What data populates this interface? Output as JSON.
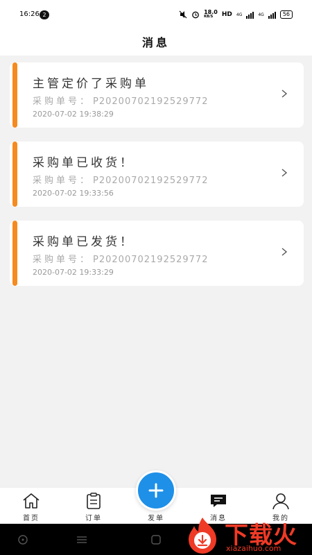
{
  "status_bar": {
    "time": "16:26",
    "notification_count": "2",
    "speed": "18.0",
    "speed_unit": "KB/S",
    "hd_label": "HD",
    "network_1": "4G",
    "network_2": "4G",
    "battery": "56"
  },
  "header": {
    "title": "消息"
  },
  "messages": [
    {
      "title": "主管定价了采购单",
      "order_label": "采购单号：",
      "order_no": "P20200702192529772",
      "time": "2020-07-02 19:38:29"
    },
    {
      "title": "采购单已收货！",
      "order_label": "采购单号：",
      "order_no": "P20200702192529772",
      "time": "2020-07-02 19:33:56"
    },
    {
      "title": "采购单已发货！",
      "order_label": "采购单号：",
      "order_no": "P20200702192529772",
      "time": "2020-07-02 19:33:29"
    }
  ],
  "tabbar": {
    "tabs": [
      {
        "label": "首页",
        "icon": "home-icon"
      },
      {
        "label": "订单",
        "icon": "clipboard-icon"
      },
      {
        "label": "发单",
        "icon": "plus-icon"
      },
      {
        "label": "消息",
        "icon": "message-icon"
      },
      {
        "label": "我的",
        "icon": "user-icon"
      }
    ]
  },
  "colors": {
    "accent": "#f58a1f",
    "fab": "#1e90e8",
    "background": "#f2f2f2"
  },
  "watermark": {
    "text": "下载火",
    "url": "xiazaihuo.com"
  }
}
